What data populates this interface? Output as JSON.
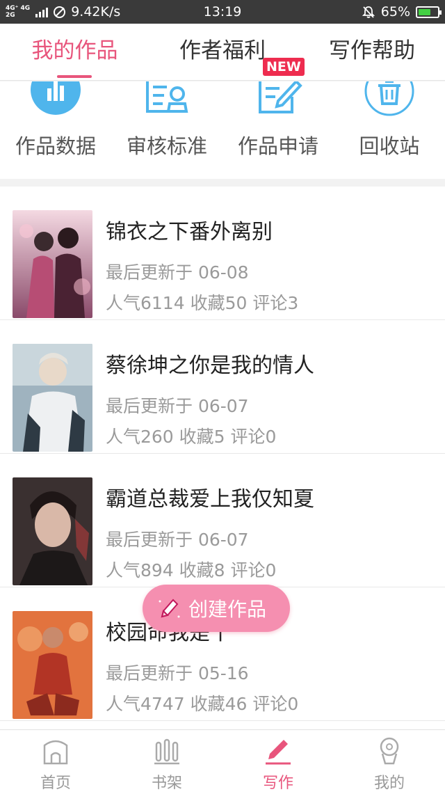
{
  "status_bar": {
    "net_top": "4G⁺ 4G",
    "net_bottom": "2G",
    "speed": "9.42K/s",
    "time": "13:19",
    "battery": "65%",
    "battery_level": 0.65
  },
  "tabs": {
    "items": [
      {
        "label": "我的作品"
      },
      {
        "label": "作者福利"
      },
      {
        "label": "写作帮助"
      }
    ],
    "active_index": 0,
    "new_badge": "NEW"
  },
  "quick_actions": [
    {
      "label": "作品数据",
      "icon": "bar-chart-icon"
    },
    {
      "label": "审核标准",
      "icon": "review-standard-icon"
    },
    {
      "label": "作品申请",
      "icon": "edit-document-icon"
    },
    {
      "label": "回收站",
      "icon": "trash-icon"
    }
  ],
  "works": [
    {
      "title": "锦衣之下番外离别",
      "updated": "最后更新于 06-08",
      "stats": "人气6114 收藏50 评论3"
    },
    {
      "title": "蔡徐坤之你是我的情人",
      "updated": "最后更新于 06-07",
      "stats": "人气260 收藏5 评论0"
    },
    {
      "title": "霸道总裁爱上我仅知夏",
      "updated": "最后更新于 06-07",
      "stats": "人气894 收藏8 评论0"
    },
    {
      "title": "校园命我是十",
      "updated": "最后更新于 05-16",
      "stats": "人气4747 收藏46 评论0"
    }
  ],
  "fab": {
    "label": "创建作品",
    "icon": "pencil-icon"
  },
  "bottom_nav": {
    "items": [
      {
        "label": "首页",
        "icon": "home-icon"
      },
      {
        "label": "书架",
        "icon": "bookshelf-icon"
      },
      {
        "label": "写作",
        "icon": "write-icon"
      },
      {
        "label": "我的",
        "icon": "profile-icon"
      }
    ],
    "active_index": 2
  },
  "colors": {
    "accent": "#e8557c",
    "badge": "#ee2c4f",
    "icon_blue": "#4fb5ec",
    "fab": "#f58fb0"
  }
}
